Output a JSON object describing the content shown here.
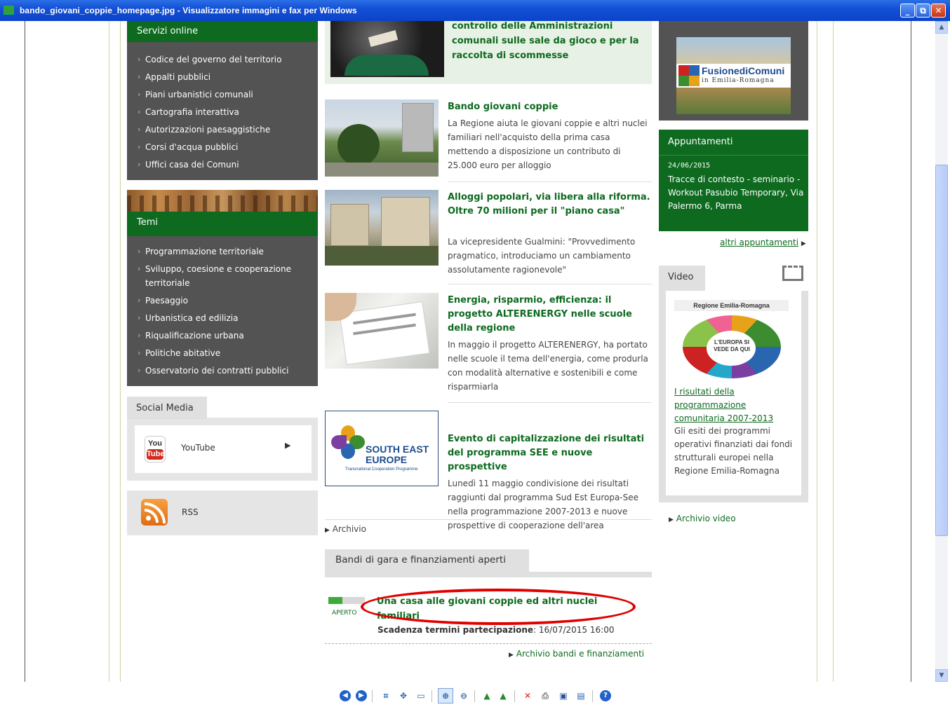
{
  "window": {
    "title": "bando_giovani_coppie_homepage.jpg - Visualizzatore immagini e fax per Windows",
    "minimize": "_",
    "maximize": "⧉",
    "close": "✕"
  },
  "left": {
    "services": {
      "heading": "Servizi online",
      "items": [
        "Codice del governo del territorio",
        "Appalti pubblici",
        "Piani urbanistici comunali",
        "Cartografia interattiva",
        "Autorizzazioni paesaggistiche",
        "Corsi d'acqua pubblici",
        "Uffici casa dei Comuni"
      ]
    },
    "temi": {
      "heading": "Temi",
      "items": [
        "Programmazione territoriale",
        "Sviluppo, coesione e cooperazione territoriale",
        "Paesaggio",
        "Urbanistica ed edilizia",
        "Riqualificazione urbana",
        "Politiche abitative",
        "Osservatorio dei contratti pubblici"
      ]
    },
    "social": {
      "heading": "Social Media",
      "youtube_logo": "You Tube",
      "youtube": "YouTube",
      "rss": "RSS"
    }
  },
  "center": {
    "top_title": "controllo delle Amministrazioni comunali sulle sale da gioco e per la raccolta di scommesse",
    "news": [
      {
        "title": "Bando giovani coppie",
        "text": "La Regione aiuta le giovani coppie e altri nuclei familiari nell'acquisto della prima casa mettendo a disposizione un contributo di 25.000 euro per alloggio"
      },
      {
        "title": "Alloggi popolari, via libera alla riforma. Oltre 70 milioni per il \"piano casa\"",
        "text": "La vicepresidente Gualmini: \"Provvedimento pragmatico, introduciamo un cambiamento assolutamente ragionevole\""
      },
      {
        "title": "Energia, risparmio, efficienza: il progetto ALTERENERGY nelle scuole della regione",
        "text": "In maggio il progetto ALTERENERGY, ha portato nelle scuole il tema dell'energia, come produrla con modalità alternative e sostenibili e come risparmiarla"
      },
      {
        "title": "Evento di capitalizzazione dei risultati del programma SEE e nuove prospettive",
        "text": "Lunedì 11 maggio condivisione dei risultati raggiunti dal programma Sud Est Europa-See nella programmazione 2007-2013 e nuove prospettive di cooperazione dell'area",
        "logo_line1": "SOUTH EAST",
        "logo_line2": "EUROPE",
        "logo_line3": "Transnational Cooperation Programme"
      }
    ],
    "archivio": "Archivio",
    "bandi": {
      "heading": "Bandi di gara e finanziamenti aperti",
      "status": "APERTO",
      "title": "Una casa alle giovani coppie ed altri nuclei familiari",
      "deadline_label": "Scadenza termini partecipazione",
      "deadline_value": ": 16/07/2015 16:00",
      "archive_link": "Archivio bandi e finanziamenti"
    }
  },
  "right": {
    "fusione": {
      "line1": "FusionediComuni",
      "line2": "in Emilia-Romagna"
    },
    "appuntamenti": {
      "heading": "Appuntamenti",
      "date": "24/06/2015",
      "text": "Tracce di contesto - seminario - Workout Pasubio Temporary, Via Palermo 6, Parma",
      "more": "altri appuntamenti"
    },
    "video": {
      "heading": "Video",
      "thumb_caption": "Regione Emilia-Romagna",
      "thumb_text": "L'EUROPA SI VEDE DA QUI",
      "link": "I risultati della programmazione comunitaria 2007-2013",
      "text": "Gli esiti dei programmi operativi finanziati dai fondi strutturali europei nella Regione Emilia-Romagna",
      "archive": "Archivio video"
    }
  },
  "colors": {
    "green": "#0d6a1f",
    "dark_panel": "#535353",
    "annotation": "#e00000",
    "titlebar": "#1450d4"
  },
  "toolbar": {
    "icons": [
      "previous-image-icon",
      "next-image-icon",
      "best-fit-icon",
      "actual-size-icon",
      "slideshow-icon",
      "zoom-in-icon",
      "zoom-out-icon",
      "rotate-clockwise-icon",
      "rotate-counterclockwise-icon",
      "delete-icon",
      "print-icon",
      "save-icon",
      "open-editor-icon",
      "help-icon"
    ]
  }
}
